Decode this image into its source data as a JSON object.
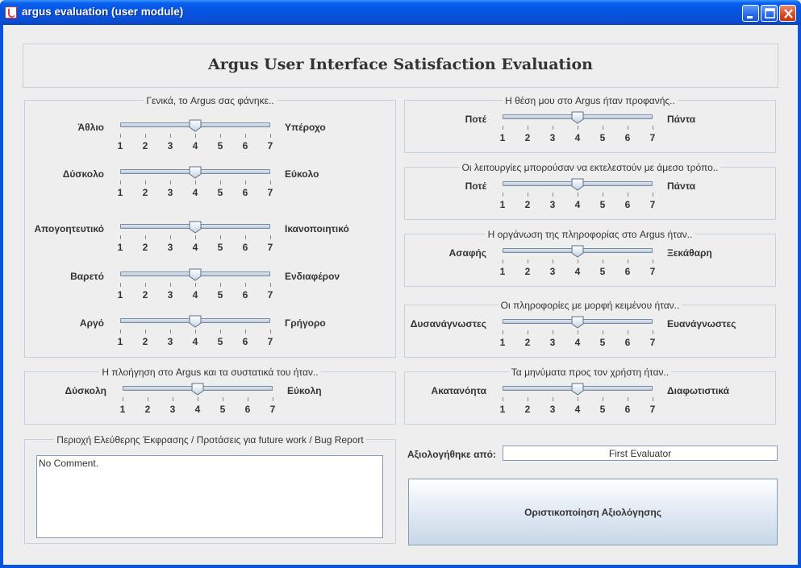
{
  "window": {
    "title": "argus evaluation (user module)",
    "icon": "java-cup-icon"
  },
  "header": {
    "title": "Argus User Interface Satisfaction Evaluation"
  },
  "scale_ticks": [
    "1",
    "2",
    "3",
    "4",
    "5",
    "6",
    "7"
  ],
  "general": {
    "legend": "Γενικά, το Argus σας φάνηκε..",
    "rows": [
      {
        "left": "Άθλιο",
        "right": "Υπέροχο",
        "value": 4
      },
      {
        "left": "Δύσκολο",
        "right": "Εύκολο",
        "value": 4
      },
      {
        "left": "Απογοητευτικό",
        "right": "Ικανοποιητικό",
        "value": 4
      },
      {
        "left": "Βαρετό",
        "right": "Ενδιαφέρον",
        "value": 4
      },
      {
        "left": "Αργό",
        "right": "Γρήγορο",
        "value": 4
      }
    ]
  },
  "navigation": {
    "legend": "Η πλοήγηση στο Argus και τα συστατικά του ήταν..",
    "row": {
      "left": "Δύσκολη",
      "right": "Εύκολη",
      "value": 4
    }
  },
  "right_groups": [
    {
      "legend": "Η θέση μου στο Argus ήταν προφανής..",
      "left": "Ποτέ",
      "right": "Πάντα",
      "value": 4
    },
    {
      "legend": "Οι λειτουργίες μπορούσαν να εκτελεστούν με άμεσο τρόπο..",
      "left": "Ποτέ",
      "right": "Πάντα",
      "value": 4
    },
    {
      "legend": "Η οργάνωση της πληροφορίας στο Argus ήταν..",
      "left": "Ασαφής",
      "right": "Ξεκάθαρη",
      "value": 4
    },
    {
      "legend": "Οι πληροφορίες με μορφή κειμένου ήταν..",
      "left": "Δυσανάγνωστες",
      "right": "Ευανάγνωστες",
      "value": 4
    },
    {
      "legend": "Τα μηνύματα προς τον χρήστη ήταν..",
      "left": "Ακατανόητα",
      "right": "Διαφωτιστικά",
      "value": 4
    }
  ],
  "comments": {
    "legend": "Περιοχή Ελεύθερης Έκφρασης / Προτάσεις για future work / Bug Report",
    "value": "No Comment."
  },
  "evaluator": {
    "label": "Αξιολογήθηκε από:",
    "value": "First Evaluator"
  },
  "finalize_button": {
    "label": "Οριστικοποίηση Αξιολόγησης"
  }
}
